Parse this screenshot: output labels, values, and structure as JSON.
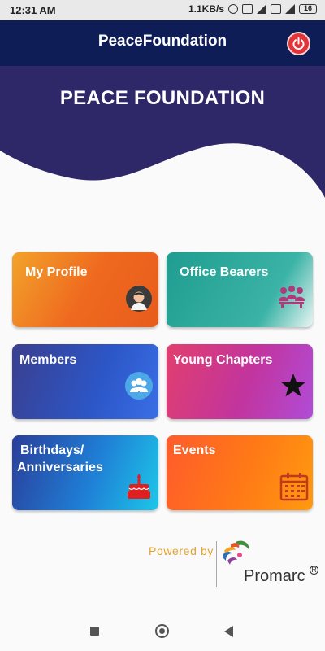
{
  "status_bar": {
    "time": "12:31 AM",
    "network_speed": "1.1KB/s",
    "battery": "16"
  },
  "app_bar": {
    "title": "PeaceFoundation",
    "power_icon": "power-icon",
    "accent": "#e0343a",
    "background": "#0f1d57"
  },
  "header": {
    "title": "PEACE FOUNDATION",
    "wave_color": "#2e2868"
  },
  "tiles": [
    {
      "label": "My Profile",
      "icon": "avatar-icon"
    },
    {
      "label": "Office Bearers",
      "icon": "group-icon"
    },
    {
      "label": "Members",
      "icon": "members-icon"
    },
    {
      "label": "Young Chapters",
      "icon": "star-icon"
    },
    {
      "label_line1": "Birthdays/",
      "label_line2": "Anniversaries",
      "icon": "cake-icon"
    },
    {
      "label": "Events",
      "icon": "calendar-icon"
    }
  ],
  "footer": {
    "powered_by": "Powered by",
    "brand": "Promarc",
    "registered": "R"
  },
  "nav": {
    "recent": "square-icon",
    "home": "circle-icon",
    "back": "back-triangle-icon"
  }
}
